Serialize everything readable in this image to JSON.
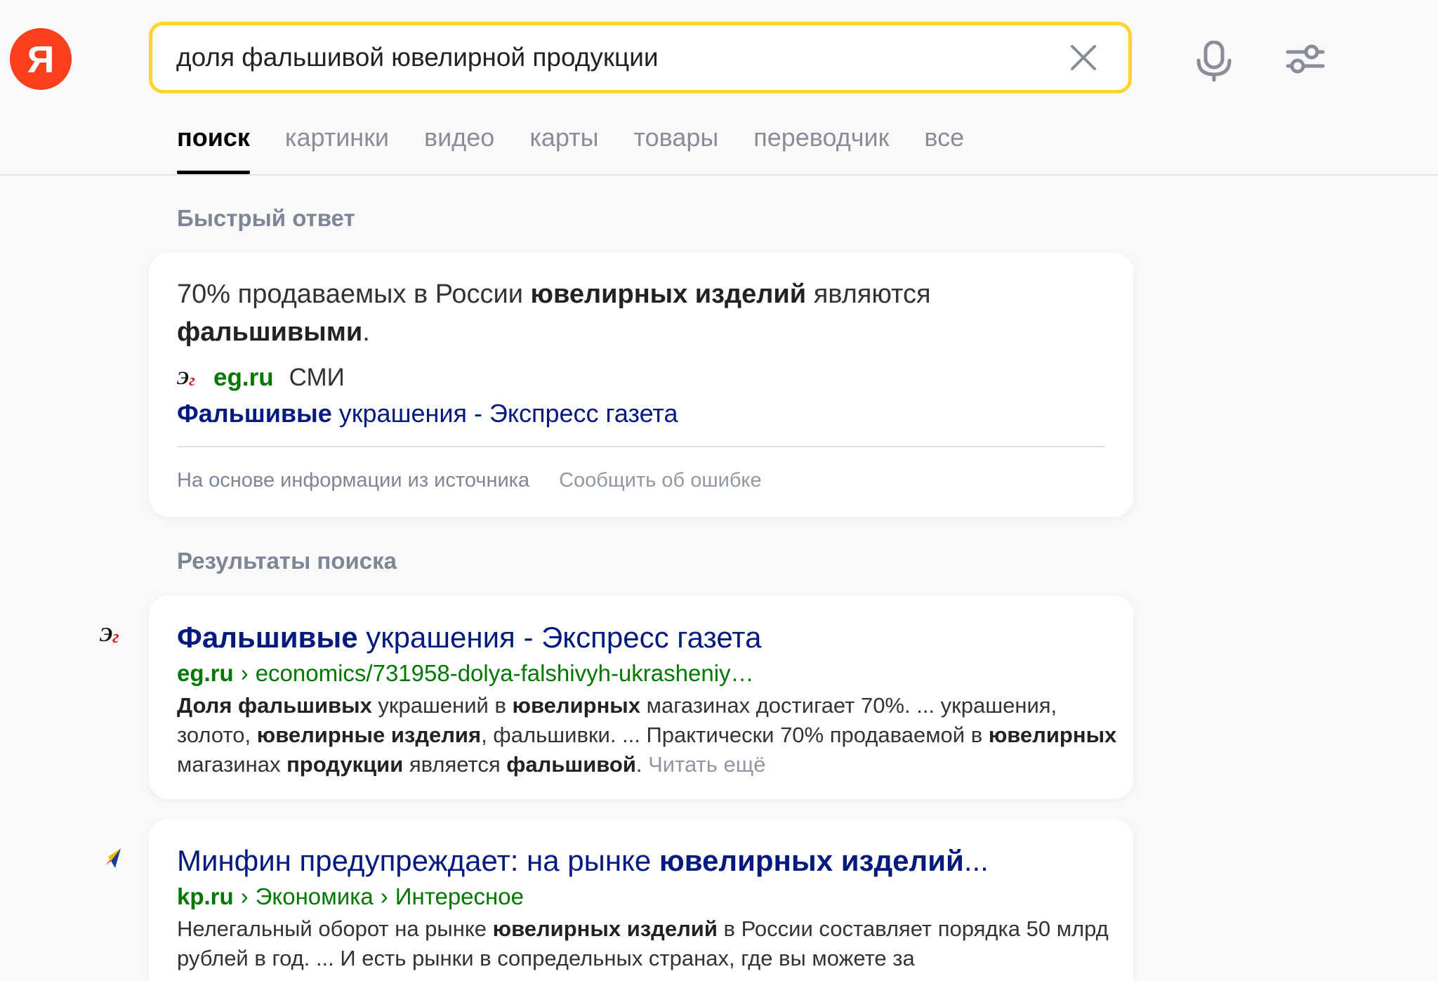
{
  "header": {
    "logo_letter": "Я",
    "search_value": "доля фальшивой ювелирной продукции"
  },
  "tabs": [
    {
      "label": "поиск",
      "active": true
    },
    {
      "label": "картинки",
      "active": false
    },
    {
      "label": "видео",
      "active": false
    },
    {
      "label": "карты",
      "active": false
    },
    {
      "label": "товары",
      "active": false
    },
    {
      "label": "переводчик",
      "active": false
    },
    {
      "label": "все",
      "active": false
    }
  ],
  "quick_answer": {
    "section_title": "Быстрый ответ",
    "text_parts": [
      {
        "t": "70% продаваемых в России ",
        "b": false
      },
      {
        "t": "ювелирных изделий",
        "b": true
      },
      {
        "t": " являются ",
        "b": false
      },
      {
        "t": "фальшивыми",
        "b": true
      },
      {
        "t": ".",
        "b": false
      }
    ],
    "source_domain": "eg.ru",
    "source_type": "СМИ",
    "link_parts": [
      {
        "t": "Фальшивые",
        "b": true
      },
      {
        "t": " украшения - Экспресс газета",
        "b": false
      }
    ],
    "footer_info": "На основе информации из источника",
    "footer_report": "Сообщить об ошибке"
  },
  "results_section_title": "Результаты поиска",
  "results": [
    {
      "favicon": "eg-logo-icon",
      "title_parts": [
        {
          "t": "Фальшивые",
          "b": true
        },
        {
          "t": " украшения - Экспресс газета",
          "b": false
        }
      ],
      "domain": "eg.ru",
      "path": [
        "economics/731958-dolya-falshivyh-ukrasheniy…"
      ],
      "snippet_parts": [
        {
          "t": "Доля фальшивых",
          "b": true
        },
        {
          "t": " украшений в ",
          "b": false
        },
        {
          "t": "ювелирных",
          "b": true
        },
        {
          "t": " магазинах достигает 70%. ... украшения, золото, ",
          "b": false
        },
        {
          "t": "ювелирные изделия",
          "b": true
        },
        {
          "t": ", фальшивки. ... Практически 70% продаваемой в ",
          "b": false
        },
        {
          "t": "ювелирных",
          "b": true
        },
        {
          "t": " магазинах ",
          "b": false
        },
        {
          "t": "продукции",
          "b": true
        },
        {
          "t": " является ",
          "b": false
        },
        {
          "t": "фальшивой",
          "b": true
        },
        {
          "t": ". ",
          "b": false
        }
      ],
      "more": "Читать ещё"
    },
    {
      "favicon": "kp-logo-icon",
      "title_parts": [
        {
          "t": "Минфин предупреждает: на рынке ",
          "b": false
        },
        {
          "t": "ювелирных изделий",
          "b": true
        },
        {
          "t": "...",
          "b": false
        }
      ],
      "domain": "kp.ru",
      "path": [
        "Экономика",
        "Интересное"
      ],
      "snippet_parts": [
        {
          "t": "Нелегальный оборот на рынке ",
          "b": false
        },
        {
          "t": "ювелирных изделий",
          "b": true
        },
        {
          "t": " в России составляет порядка 50 млрд рублей в год. ... И есть рынки в сопредельных странах, где вы можете за",
          "b": false
        }
      ],
      "more": ""
    }
  ]
}
